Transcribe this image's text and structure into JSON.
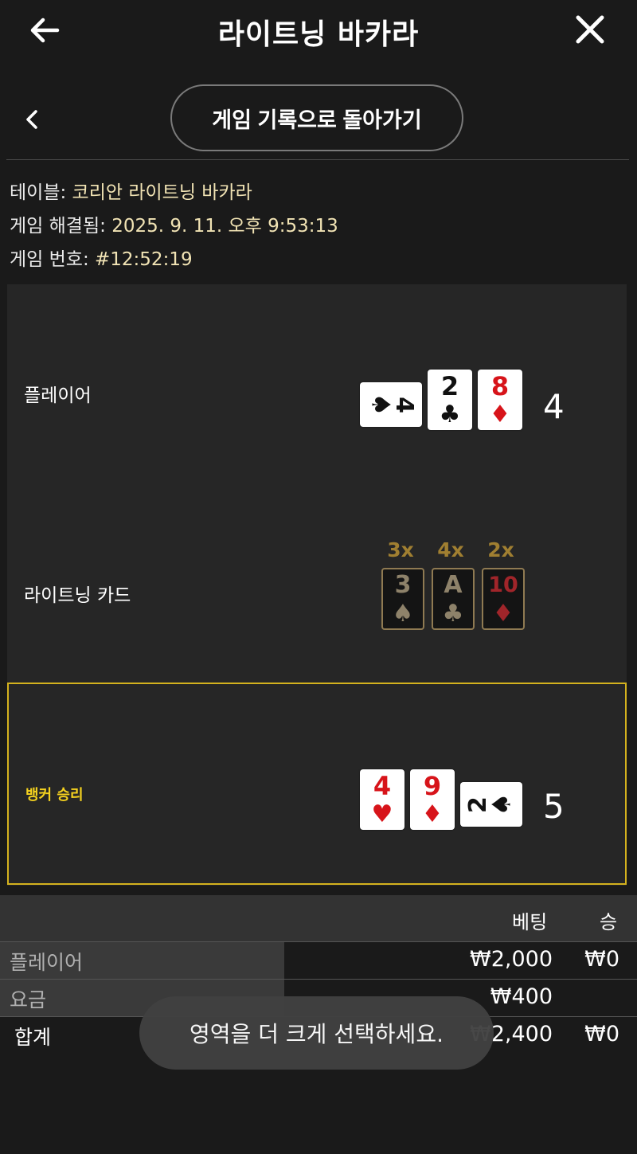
{
  "header": {
    "title": "라이트닝 바카라"
  },
  "nav": {
    "back_to_history": "게임 기록으로 돌아가기"
  },
  "info": {
    "table_label": "테이블:",
    "table_value": "코리안 라이트닝 바카라",
    "resolved_label": "게임 해결됨:",
    "resolved_value": "2025. 9. 11. 오후 9:53:13",
    "game_no_label": "게임 번호:",
    "game_no_value": "#12:52:19"
  },
  "player": {
    "label": "플레이어",
    "score": "4",
    "cards": [
      {
        "rank": "4",
        "suit": "♠",
        "orientation": "horizontal"
      },
      {
        "rank": "2",
        "suit": "♣",
        "orientation": "vertical"
      },
      {
        "rank": "8",
        "suit": "♦",
        "orientation": "vertical"
      }
    ]
  },
  "lightning": {
    "label": "라이트닝 카드",
    "cards": [
      {
        "rank": "3",
        "suit": "♠",
        "multiplier": "3x"
      },
      {
        "rank": "A",
        "suit": "♣",
        "multiplier": "4x"
      },
      {
        "rank": "10",
        "suit": "♦",
        "multiplier": "2x"
      }
    ]
  },
  "banker": {
    "label": "뱅커 승리",
    "score": "5",
    "cards": [
      {
        "rank": "4",
        "suit": "♥",
        "orientation": "vertical"
      },
      {
        "rank": "9",
        "suit": "♦",
        "orientation": "vertical"
      },
      {
        "rank": "2",
        "suit": "♠",
        "orientation": "horizontal"
      }
    ]
  },
  "table": {
    "headers": {
      "bet": "베팅",
      "win": "승"
    },
    "rows": [
      {
        "label": "플레이어",
        "bet": "₩2,000",
        "win": "₩0"
      },
      {
        "label": "요금",
        "bet": "₩400",
        "win": ""
      },
      {
        "label": "합계",
        "bet": "₩2,400",
        "win": "₩0"
      }
    ]
  },
  "toast": {
    "message": "영역을 더 크게 선택하세요."
  },
  "colors": {
    "accent_gold": "#f5d21f",
    "info_value": "#f1e3b4",
    "multiplier": "#a07f31"
  }
}
